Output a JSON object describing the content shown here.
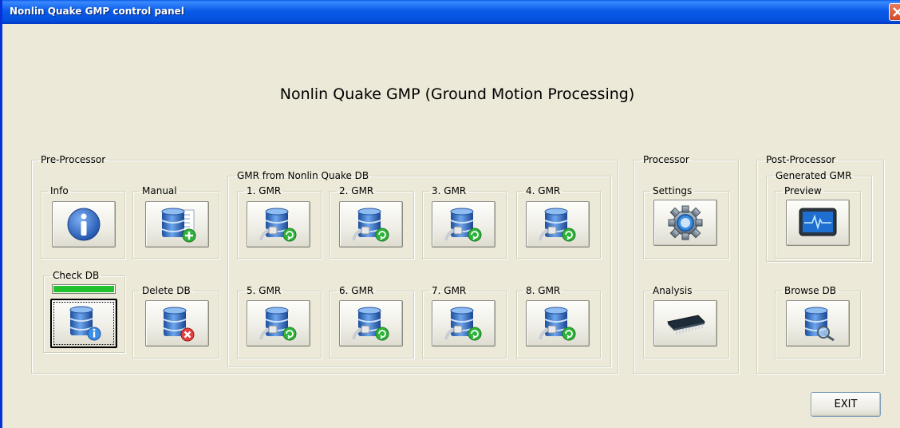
{
  "window": {
    "title": "Nonlin Quake GMP control panel"
  },
  "heading": "Nonlin Quake GMP (Ground Motion Processing)",
  "pre_processor": {
    "label": "Pre-Processor",
    "info": {
      "label": "Info",
      "icon": "info-icon"
    },
    "manual": {
      "label": "Manual",
      "icon": "database-add-icon"
    },
    "check_db": {
      "label": "Check DB",
      "icon": "database-info-icon",
      "progress": 1.0
    },
    "delete_db": {
      "label": "Delete DB",
      "icon": "database-delete-icon"
    },
    "gmr_db": {
      "label": "GMR from Nonlin Quake DB",
      "items": [
        {
          "label": "1. GMR",
          "icon": "database-plug-icon"
        },
        {
          "label": "2. GMR",
          "icon": "database-plug-icon"
        },
        {
          "label": "3. GMR",
          "icon": "database-plug-icon"
        },
        {
          "label": "4. GMR",
          "icon": "database-plug-icon"
        },
        {
          "label": "5. GMR",
          "icon": "database-plug-icon"
        },
        {
          "label": "6. GMR",
          "icon": "database-plug-icon"
        },
        {
          "label": "7. GMR",
          "icon": "database-plug-icon"
        },
        {
          "label": "8. GMR",
          "icon": "database-plug-icon"
        }
      ]
    }
  },
  "processor": {
    "label": "Processor",
    "settings": {
      "label": "Settings",
      "icon": "gear-icon"
    },
    "analysis": {
      "label": "Analysis",
      "icon": "chip-icon"
    }
  },
  "post_processor": {
    "label": "Post-Processor",
    "generated": {
      "label": "Generated GMR",
      "preview": {
        "label": "Preview",
        "icon": "monitor-waveform-icon"
      }
    },
    "browse_db": {
      "label": "Browse DB",
      "icon": "database-search-icon"
    }
  },
  "exit_label": "EXIT",
  "colors": {
    "titlebar": "#0a5be8",
    "background": "#ece9d8",
    "progress": "#22c12e",
    "db_blue": "#2d6bc4"
  }
}
